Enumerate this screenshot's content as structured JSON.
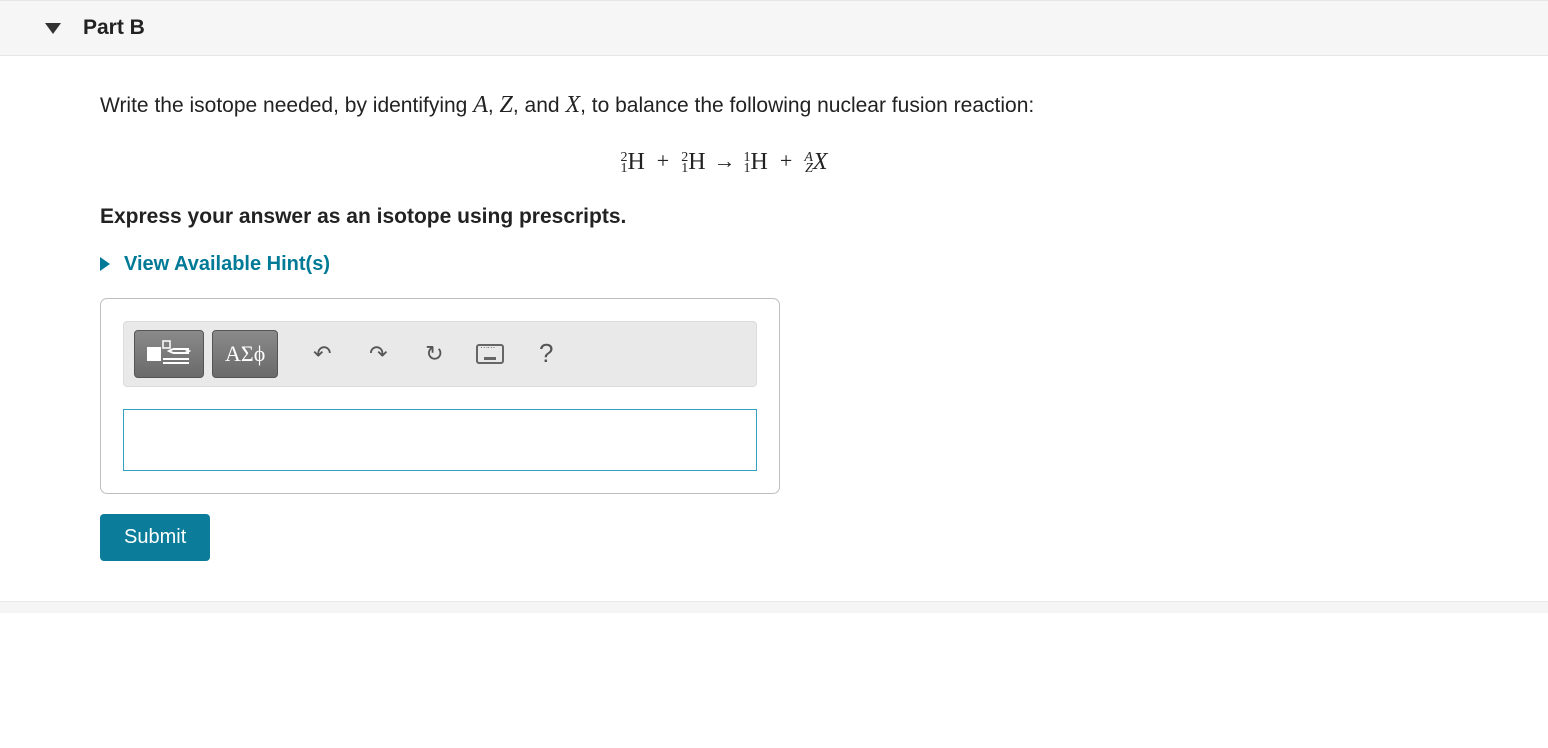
{
  "part": {
    "label": "Part B"
  },
  "prompt": {
    "pre": "Write the isotope needed, by identifying ",
    "v1": "A",
    "c1": ", ",
    "v2": "Z",
    "c2": ", and ",
    "v3": "X",
    "post": ", to balance the following nuclear fusion reaction:"
  },
  "equation": {
    "t1": {
      "A": "2",
      "Z": "1",
      "X": "H"
    },
    "t2": {
      "A": "2",
      "Z": "1",
      "X": "H"
    },
    "t3": {
      "A": "1",
      "Z": "1",
      "X": "H"
    },
    "t4": {
      "A": "A",
      "Z": "Z",
      "X": "X"
    }
  },
  "instruction": "Express your answer as an isotope using prescripts.",
  "hints_label": "View Available Hint(s)",
  "toolbar": {
    "templates_label": "templates",
    "greek_label": "ΑΣϕ",
    "undo": "↶",
    "redo": "↷",
    "reset": "↻",
    "help": "?"
  },
  "answer_value": "",
  "submit_label": "Submit"
}
